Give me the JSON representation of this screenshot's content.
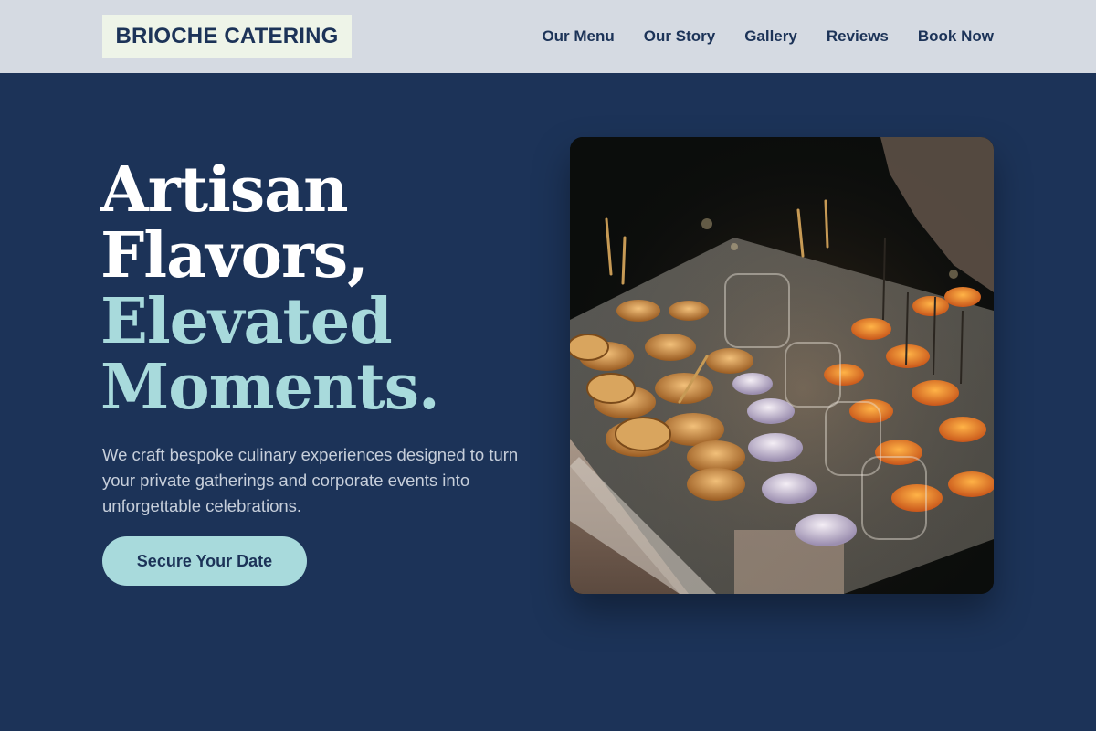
{
  "brand": {
    "name": "BRIOCHE CATERING"
  },
  "nav": {
    "links": [
      {
        "label": "Our Menu"
      },
      {
        "label": "Our Story"
      },
      {
        "label": "Gallery"
      },
      {
        "label": "Reviews"
      },
      {
        "label": "Book Now"
      }
    ]
  },
  "hero": {
    "title_lines": [
      "Artisan",
      "Flavors,",
      "Elevated",
      "Moments."
    ],
    "description": "We craft bespoke culinary experiences designed to turn your private gatherings and corporate events into unforgettable celebrations.",
    "cta_label": "Secure Your Date"
  },
  "colors": {
    "navy": "#1c3358",
    "nav_bg": "#d5dae2",
    "logo_bg": "#eef4e8",
    "accent_teal": "#a8dadc",
    "body_text": "#c7cfdb"
  },
  "image": {
    "subject": "catering-appetizers-photo"
  }
}
